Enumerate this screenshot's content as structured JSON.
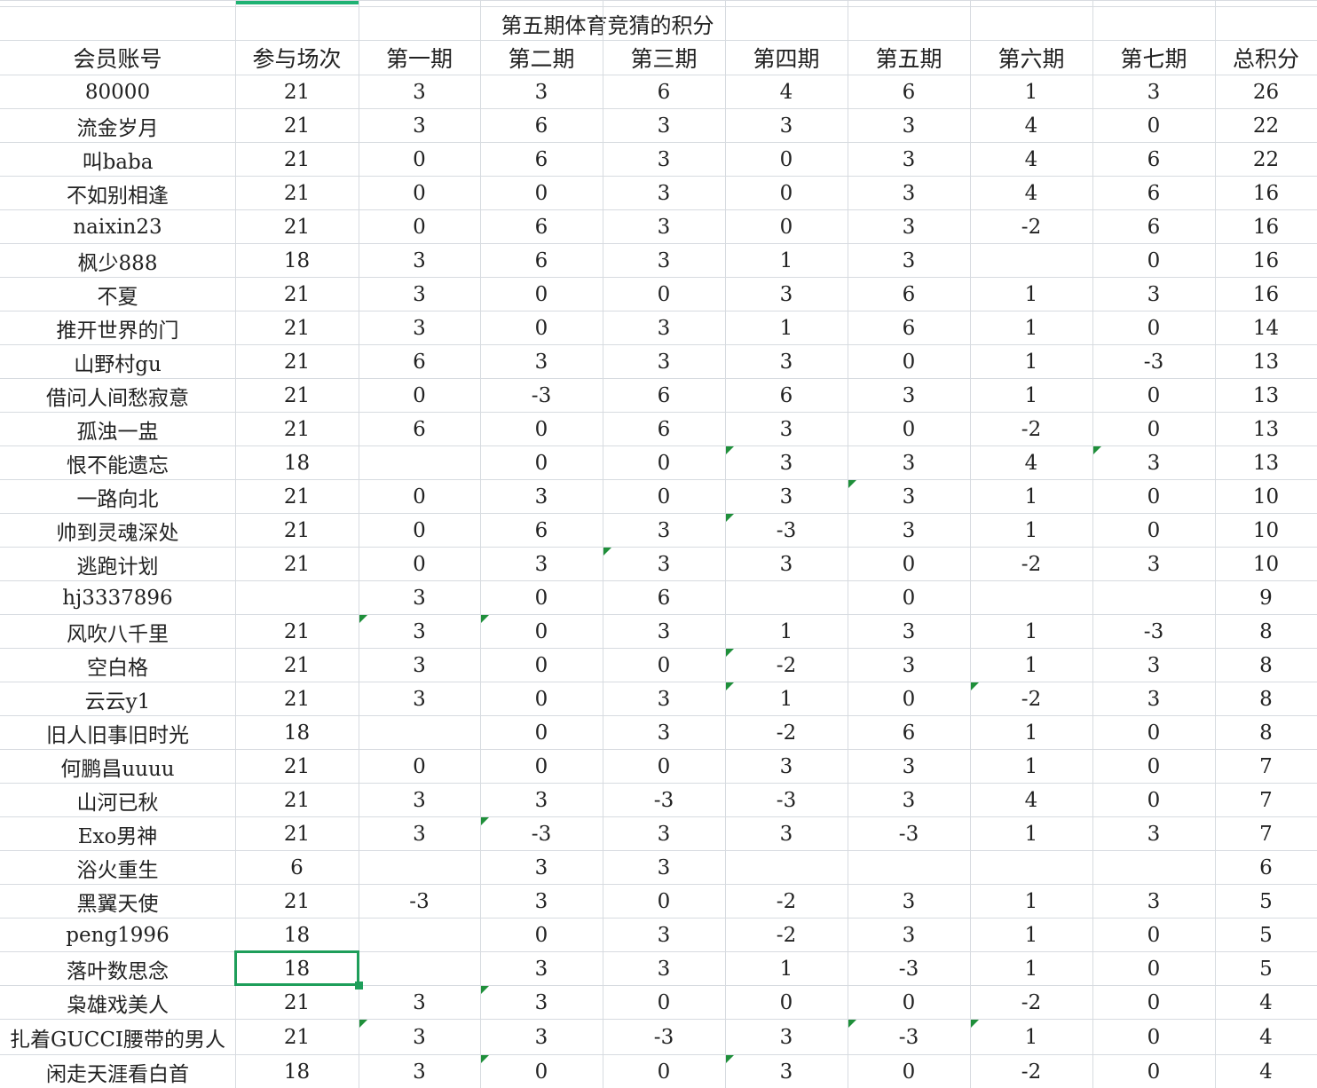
{
  "sheet": {
    "title": "第五期体育竞猜的积分",
    "headers": [
      "会员账号",
      "参与场次",
      "第一期",
      "第二期",
      "第三期",
      "第四期",
      "第五期",
      "第六期",
      "第七期",
      "总积分"
    ],
    "rows": [
      [
        "80000",
        "21",
        "3",
        "3",
        "6",
        "4",
        "6",
        "1",
        "3",
        "26"
      ],
      [
        "流金岁月",
        "21",
        "3",
        "6",
        "3",
        "3",
        "3",
        "4",
        "0",
        "22"
      ],
      [
        "叫baba",
        "21",
        "0",
        "6",
        "3",
        "0",
        "3",
        "4",
        "6",
        "22"
      ],
      [
        "不如别相逢",
        "21",
        "0",
        "0",
        "3",
        "0",
        "3",
        "4",
        "6",
        "16"
      ],
      [
        "naixin23",
        "21",
        "0",
        "6",
        "3",
        "0",
        "3",
        "-2",
        "6",
        "16"
      ],
      [
        "枫少888",
        "18",
        "3",
        "6",
        "3",
        "1",
        "3",
        "",
        "0",
        "16"
      ],
      [
        "不夏",
        "21",
        "3",
        "0",
        "0",
        "3",
        "6",
        "1",
        "3",
        "16"
      ],
      [
        "推开世界的门",
        "21",
        "3",
        "0",
        "3",
        "1",
        "6",
        "1",
        "0",
        "14"
      ],
      [
        "山野村gu",
        "21",
        "6",
        "3",
        "3",
        "3",
        "0",
        "1",
        "-3",
        "13"
      ],
      [
        "借问人间愁寂意",
        "21",
        "0",
        "-3",
        "6",
        "6",
        "3",
        "1",
        "0",
        "13"
      ],
      [
        "孤浊一盅",
        "21",
        "6",
        "0",
        "6",
        "3",
        "0",
        "-2",
        "0",
        "13"
      ],
      [
        "恨不能遗忘",
        "18",
        "",
        "0",
        "0",
        "3",
        "3",
        "4",
        "3",
        "13"
      ],
      [
        "一路向北",
        "21",
        "0",
        "3",
        "0",
        "3",
        "3",
        "1",
        "0",
        "10"
      ],
      [
        "帅到灵魂深处",
        "21",
        "0",
        "6",
        "3",
        "-3",
        "3",
        "1",
        "0",
        "10"
      ],
      [
        "逃跑计划",
        "21",
        "0",
        "3",
        "3",
        "3",
        "0",
        "-2",
        "3",
        "10"
      ],
      [
        "hj3337896",
        "",
        "3",
        "0",
        "6",
        "",
        "0",
        "",
        "",
        "9"
      ],
      [
        "风吹八千里",
        "21",
        "3",
        "0",
        "3",
        "1",
        "3",
        "1",
        "-3",
        "8"
      ],
      [
        "空白格",
        "21",
        "3",
        "0",
        "0",
        "-2",
        "3",
        "1",
        "3",
        "8"
      ],
      [
        "云云y1",
        "21",
        "3",
        "0",
        "3",
        "1",
        "0",
        "-2",
        "3",
        "8"
      ],
      [
        "旧人旧事旧时光",
        "18",
        "",
        "0",
        "3",
        "-2",
        "6",
        "1",
        "0",
        "8"
      ],
      [
        "何鹏昌uuuu",
        "21",
        "0",
        "0",
        "0",
        "3",
        "3",
        "1",
        "0",
        "7"
      ],
      [
        "山河已秋",
        "21",
        "3",
        "3",
        "-3",
        "-3",
        "3",
        "4",
        "0",
        "7"
      ],
      [
        "Exo男神",
        "21",
        "3",
        "-3",
        "3",
        "3",
        "-3",
        "1",
        "3",
        "7"
      ],
      [
        "浴火重生",
        "6",
        "",
        "3",
        "3",
        "",
        "",
        "",
        "",
        "6"
      ],
      [
        "黑翼天使",
        "21",
        "-3",
        "3",
        "0",
        "-2",
        "3",
        "1",
        "3",
        "5"
      ],
      [
        "peng1996",
        "18",
        "",
        "0",
        "3",
        "-2",
        "3",
        "1",
        "0",
        "5"
      ],
      [
        "落叶数思念",
        "18",
        "",
        "3",
        "3",
        "1",
        "-3",
        "1",
        "0",
        "5"
      ],
      [
        "枭雄戏美人",
        "21",
        "3",
        "3",
        "0",
        "0",
        "0",
        "-2",
        "0",
        "4"
      ],
      [
        "扎着GUCCI腰带的男人",
        "21",
        "3",
        "3",
        "-3",
        "3",
        "-3",
        "1",
        "0",
        "4"
      ],
      [
        "闲走天涯看白首",
        "18",
        "3",
        "0",
        "0",
        "3",
        "0",
        "-2",
        "0",
        "4"
      ]
    ]
  },
  "colors": {
    "grid": "#d7dbe0",
    "selection": "#1e9e5a",
    "comment_marker": "#1f8f3a",
    "column_highlight": "#1fb273"
  }
}
